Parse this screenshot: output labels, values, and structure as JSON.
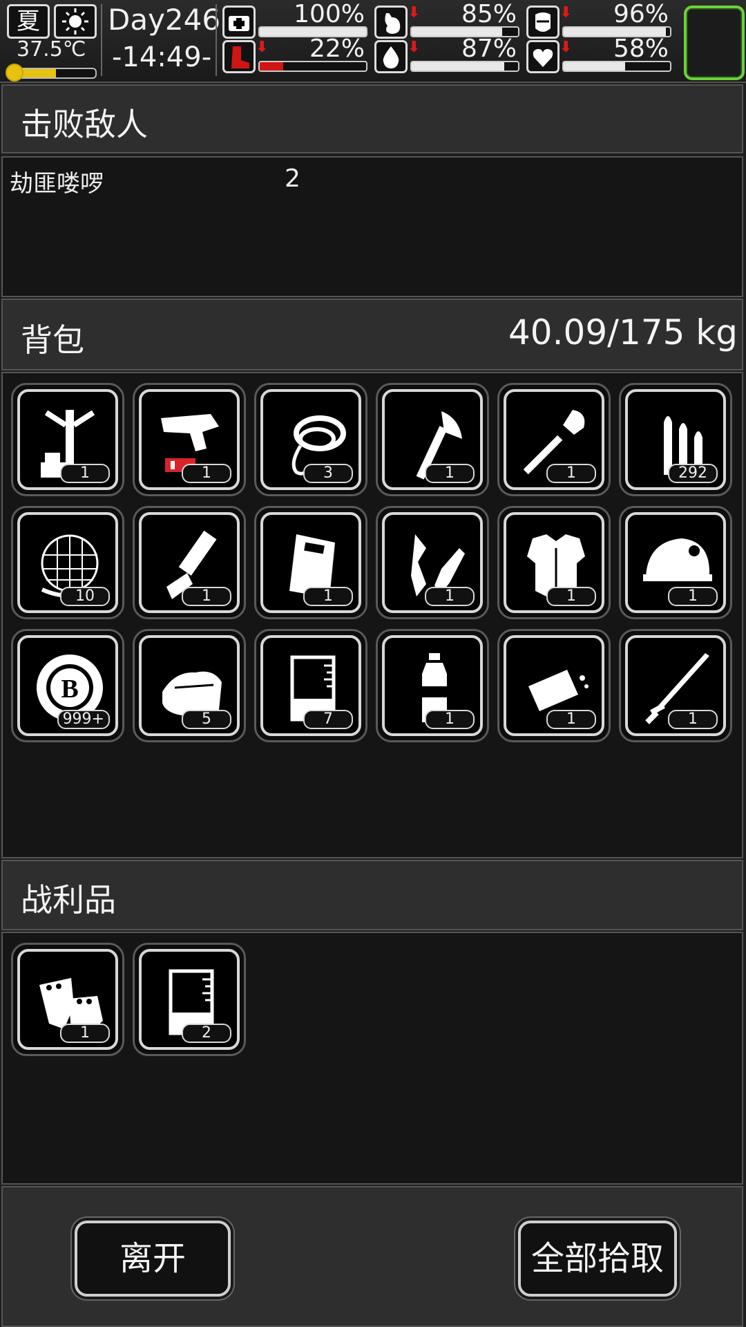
{
  "hud": {
    "season": "夏",
    "temperature": "37.5℃",
    "temperature_level": 0.55,
    "day": "Day246",
    "time": "-14:49-",
    "stats": [
      {
        "icon": "medkit-icon",
        "value": "100%",
        "level": 1.0,
        "arrow": false
      },
      {
        "icon": "stomach-icon",
        "value": "85%",
        "level": 0.85,
        "arrow": true
      },
      {
        "icon": "armor-icon",
        "value": "96%",
        "level": 0.96,
        "arrow": true
      },
      {
        "icon": "boot-icon",
        "value": "22%",
        "level": 0.22,
        "arrow": true,
        "warning": true
      },
      {
        "icon": "water-drop-icon",
        "value": "87%",
        "level": 0.87,
        "arrow": true
      },
      {
        "icon": "heart-icon",
        "value": "58%",
        "level": 0.58,
        "arrow": true
      }
    ]
  },
  "defeated": {
    "title": "击败敌人",
    "enemy_name": "劫匪喽啰",
    "enemy_count": "2"
  },
  "backpack": {
    "title": "背包",
    "weight": "40.09/175 kg",
    "items": [
      {
        "name": "crafting-stand-icon",
        "count": "1"
      },
      {
        "name": "flare-gun-icon",
        "count": "1"
      },
      {
        "name": "rope-icon",
        "count": "3"
      },
      {
        "name": "axe-icon",
        "count": "1"
      },
      {
        "name": "shovel-icon",
        "count": "1"
      },
      {
        "name": "bullets-icon",
        "count": "292"
      },
      {
        "name": "net-icon",
        "count": "10"
      },
      {
        "name": "minigun-icon",
        "count": "1"
      },
      {
        "name": "riot-shield-icon",
        "count": "1"
      },
      {
        "name": "scrap-parts-icon",
        "count": "1"
      },
      {
        "name": "body-armor-icon",
        "count": "1"
      },
      {
        "name": "helmet-icon",
        "count": "1"
      },
      {
        "name": "coin-icon",
        "count": "999+"
      },
      {
        "name": "cloth-icon",
        "count": "5"
      },
      {
        "name": "beaker-icon",
        "count": "7"
      },
      {
        "name": "water-bottle-icon",
        "count": "1"
      },
      {
        "name": "bread-icon",
        "count": "1"
      },
      {
        "name": "katana-icon",
        "count": "1"
      }
    ]
  },
  "loot": {
    "title": "战利品",
    "items": [
      {
        "name": "gloves-icon",
        "count": "1"
      },
      {
        "name": "beaker-icon",
        "count": "2"
      }
    ]
  },
  "footer": {
    "leave_label": "离开",
    "take_all_label": "全部拾取"
  }
}
